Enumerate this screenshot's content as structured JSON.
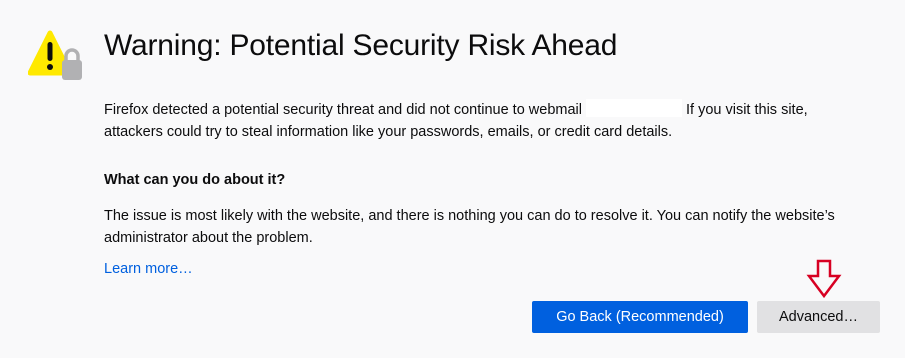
{
  "heading": {
    "title": "Warning: Potential Security Risk Ahead"
  },
  "intro": {
    "part1": "Firefox detected a potential security threat and did not continue to webmail",
    "part2": "If you visit this site, attackers could try to steal information like your passwords, emails, or credit card details."
  },
  "section": {
    "question": "What can you do about it?",
    "explanation": "The issue is most likely with the website, and there is nothing you can do to resolve it. You can notify the website’s administrator about the problem."
  },
  "links": {
    "learn_more": "Learn more…"
  },
  "buttons": {
    "go_back": "Go Back (Recommended)",
    "advanced": "Advanced…"
  },
  "icons": {
    "warning": "warning-triangle-icon",
    "lock": "lock-icon",
    "arrow": "down-arrow-icon"
  },
  "colors": {
    "primary_button": "#0060df",
    "secondary_button": "#e1e1e3",
    "warning_yellow": "#ffe900",
    "arrow_red": "#d70022",
    "background": "#f9f9fa"
  }
}
